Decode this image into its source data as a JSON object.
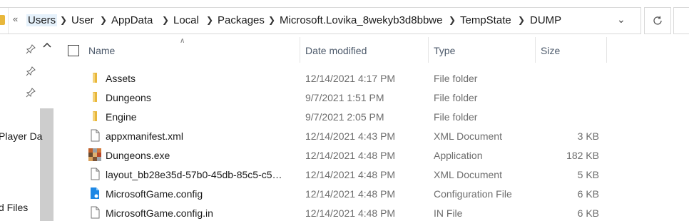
{
  "address": {
    "overflow": "«",
    "breadcrumbs": [
      "Users",
      "User",
      "AppData",
      "Local",
      "Packages",
      "Microsoft.Lovika_8wekyb3d8bbwe",
      "TempState",
      "DUMP"
    ]
  },
  "nav": {
    "items": [
      "Player Da",
      "d Files"
    ]
  },
  "columns": {
    "name": "Name",
    "date": "Date modified",
    "type": "Type",
    "size": "Size"
  },
  "files": [
    {
      "name": "Assets",
      "date": "12/14/2021 4:17 PM",
      "type": "File folder",
      "size": "",
      "icon": "folder-icon"
    },
    {
      "name": "Dungeons",
      "date": "9/7/2021 1:51 PM",
      "type": "File folder",
      "size": "",
      "icon": "folder-icon"
    },
    {
      "name": "Engine",
      "date": "9/7/2021 2:05 PM",
      "type": "File folder",
      "size": "",
      "icon": "folder-icon"
    },
    {
      "name": "appxmanifest.xml",
      "date": "12/14/2021 4:43 PM",
      "type": "XML Document",
      "size": "3 KB",
      "icon": "document-icon"
    },
    {
      "name": "Dungeons.exe",
      "date": "12/14/2021 4:48 PM",
      "type": "Application",
      "size": "182 KB",
      "icon": "application-icon"
    },
    {
      "name": "layout_bb28e35d-57b0-45db-85c5-c5…",
      "date": "12/14/2021 4:48 PM",
      "type": "XML Document",
      "size": "5 KB",
      "icon": "document-icon"
    },
    {
      "name": "MicrosoftGame.config",
      "date": "12/14/2021 4:48 PM",
      "type": "Configuration File",
      "size": "6 KB",
      "icon": "config-file-icon"
    },
    {
      "name": "MicrosoftGame.config.in",
      "date": "12/14/2021 4:48 PM",
      "type": "IN File",
      "size": "6 KB",
      "icon": "document-icon"
    }
  ],
  "colors": {
    "folder": "#e8b73b",
    "config": "#1e88e5",
    "header_text": "#4d5a6b",
    "secondary_text": "#6d6d6d"
  }
}
